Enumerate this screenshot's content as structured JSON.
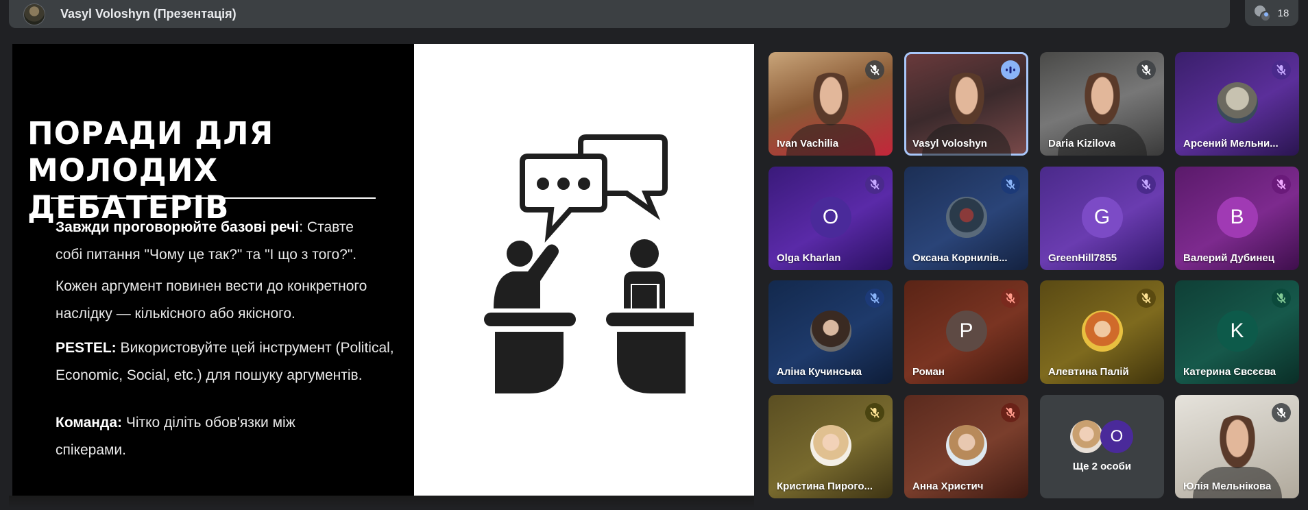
{
  "header": {
    "presenter_title": "Vasyl Voloshyn (Презентація)",
    "participant_count": "18"
  },
  "slide": {
    "title_line1": "ПОРАДИ ДЛЯ",
    "title_line2": "МОЛОДИХ  ДЕБАТЕРІВ",
    "p1_bold": "Завжди проговорюйте базові речі",
    "p1_rest": ": Ставте",
    "p1_line2": "собі питання \"Чому це так?\" та \"І що з того?\".",
    "p2_line1": "Кожен аргумент повинен вести до конкретного",
    "p2_line2": "наслідку — кількісного або якісного.",
    "p3_bold": "PESTEL:",
    "p3_rest": " Використовуйте цей інструмент (Political,",
    "p3_line2": "Economic, Social, etc.) для пошуку аргументів.",
    "p4_bold": "Команда:",
    "p4_rest": " Чітко діліть обов'язки між",
    "p4_line2": "спікерами.",
    "illustration": "debate-podium-icon"
  },
  "participants": [
    {
      "name": "Ivan Vachilia",
      "kind": "video",
      "mic": "muted"
    },
    {
      "name": "Vasyl Voloshyn",
      "kind": "video",
      "mic": "speaking"
    },
    {
      "name": "Daria Kizilova",
      "kind": "video",
      "mic": "muted"
    },
    {
      "name": "Арсений Мельни...",
      "kind": "photo",
      "mic": "muted"
    },
    {
      "name": "Olga Kharlan",
      "kind": "letter",
      "letter": "O",
      "mic": "muted"
    },
    {
      "name": "Оксана Корнилів...",
      "kind": "photo",
      "mic": "muted"
    },
    {
      "name": "GreenHill7855",
      "kind": "letter",
      "letter": "G",
      "mic": "muted"
    },
    {
      "name": "Валерий Дубинец",
      "kind": "letter",
      "letter": "B",
      "mic": "muted"
    },
    {
      "name": "Аліна Кучинська",
      "kind": "photo",
      "mic": "muted"
    },
    {
      "name": "Роман",
      "kind": "letter",
      "letter": "P",
      "mic": "muted"
    },
    {
      "name": "Алевтина Палій",
      "kind": "photo",
      "mic": "muted"
    },
    {
      "name": "Катерина Євсєєва",
      "kind": "letter",
      "letter": "K",
      "mic": "muted"
    },
    {
      "name": "Кристина Пирого...",
      "kind": "photo",
      "mic": "muted"
    },
    {
      "name": "Анна Христич",
      "kind": "photo",
      "mic": "muted"
    },
    {
      "name": "Ще 2 особи",
      "kind": "more",
      "letter": "O"
    },
    {
      "name": "Юлія Мельнікова",
      "kind": "video",
      "mic": "muted"
    }
  ],
  "colors": {
    "background": "#202124",
    "active_tile_border": "#a8c7fa"
  }
}
